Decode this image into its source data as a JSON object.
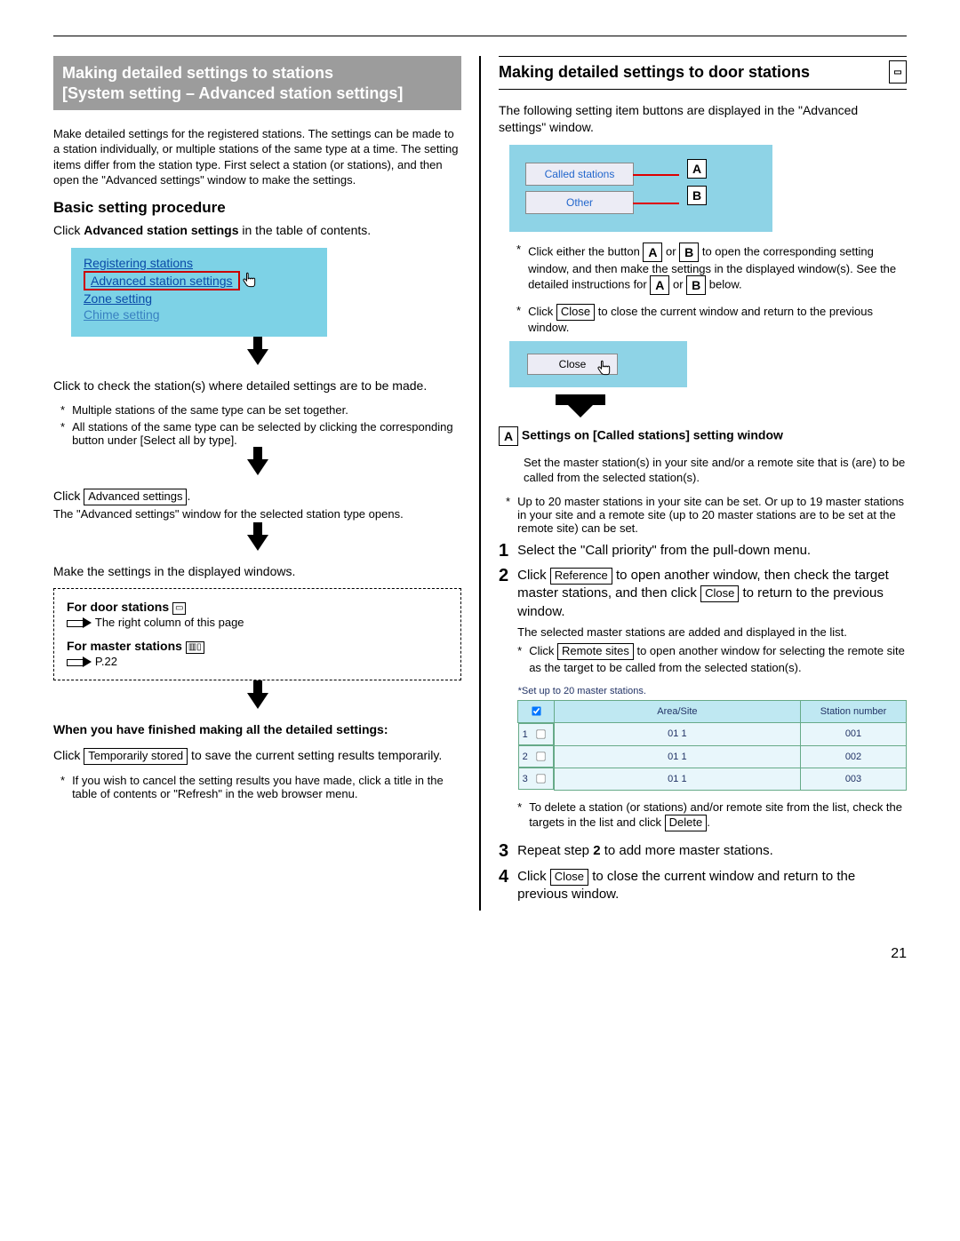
{
  "page_number": "21",
  "left": {
    "header_title": "Making detailed settings to stations",
    "header_sub": "[System setting – Advanced station settings]",
    "intro": "Make detailed settings for the registered stations. The settings can be made to a station individually, or multiple stations of the same type at a time. The setting items differ from the station type. First select a station (or stations), and then open the \"Advanced settings\" window to make the settings.",
    "h_basic": "Basic setting procedure",
    "p_click_adv_pre": "Click ",
    "p_click_adv_bold": "Advanced station settings",
    "p_click_adv_post": " in the table of contents.",
    "toc": {
      "l1": "Registering stations",
      "l2": "Advanced station settings",
      "l3": "Zone setting",
      "l4": "Chime setting"
    },
    "p_check": "Click to check the station(s) where detailed settings are to be made.",
    "b1": "Multiple stations of the same type can be set together.",
    "b2": "All stations of the same type can be selected by clicking the corresponding button under [Select all by type].",
    "p_click2_pre": "Click ",
    "btn_adv": "Advanced settings",
    "p_click2_post": ".",
    "p_click2_l2": "The \"Advanced settings\" window for the selected station type opens.",
    "p_make": "Make the settings in the displayed windows.",
    "box_door_t": "For door stations",
    "box_door_r": "The right column of this page",
    "box_master_t": "For master stations",
    "box_master_r": "P.22",
    "h_finished": "When you have finished making all the detailed settings:",
    "p_temp_pre": "Click ",
    "btn_temp": "Temporarily stored",
    "p_temp_post": " to save the current setting results temporarily.",
    "b_cancel": "If you wish to cancel the setting results you have made, click a title in the table of contents or \"Refresh\" in the web browser menu."
  },
  "right": {
    "sub_title": "Making detailed settings to door stations",
    "p_intro": "The following setting item buttons are displayed in the \"Advanced settings\" window.",
    "ui_btn_a": "Called stations",
    "ui_btn_b": "Other",
    "lbl_a": "A",
    "lbl_b": "B",
    "b_click_ab": "Click either the button A or B to open the corresponding setting window, and then make the settings in the displayed window(s). See the detailed instructions for A or B below.",
    "b_close_pre": "Click ",
    "btn_close": "Close",
    "b_close_post": " to close the current window and return to the previous window.",
    "close_label": "Close",
    "h_settings_a": "Settings on [Called stations] setting window",
    "p_set_master": "Set the master station(s) in your site and/or a remote site that is (are) to be called from the selected station(s).",
    "b_upto": "Up to 20 master stations in your site can be set. Or up to 19 master stations in your site and a remote site (up to 20 master stations are to be set at the remote site) can be set.",
    "s1": "Select the \"Call priority\" from the pull-down menu.",
    "s2_pre": "Click ",
    "btn_ref": "Reference",
    "s2_mid": " to open another window, then check the target master stations, and then click ",
    "s2_post": " to return to the previous window.",
    "s2_note": "The selected master stations are added and displayed in the list.",
    "s2_b_pre": "Click ",
    "btn_remote": "Remote sites",
    "s2_b_post": " to open another window for selecting the remote site as the target to be called from the selected station(s).",
    "tbl_cap": "*Set up to 20 master stations.",
    "tbl_h1": "",
    "tbl_h2": "Area/Site",
    "tbl_h3": "Station number",
    "rows": [
      {
        "n": "1",
        "a": "01 1",
        "s": "001"
      },
      {
        "n": "2",
        "a": "01 1",
        "s": "002"
      },
      {
        "n": "3",
        "a": "01 1",
        "s": "003"
      }
    ],
    "b_delete_pre": "To delete a station (or stations) and/or remote site from the list, check the targets in the list and click ",
    "btn_delete": "Delete",
    "b_delete_post": ".",
    "s3_pre": "Repeat step ",
    "s3_b": "2",
    "s3_post": " to add more master stations.",
    "s4_pre": "Click ",
    "s4_post": " to close the current window and return to the previous window."
  }
}
